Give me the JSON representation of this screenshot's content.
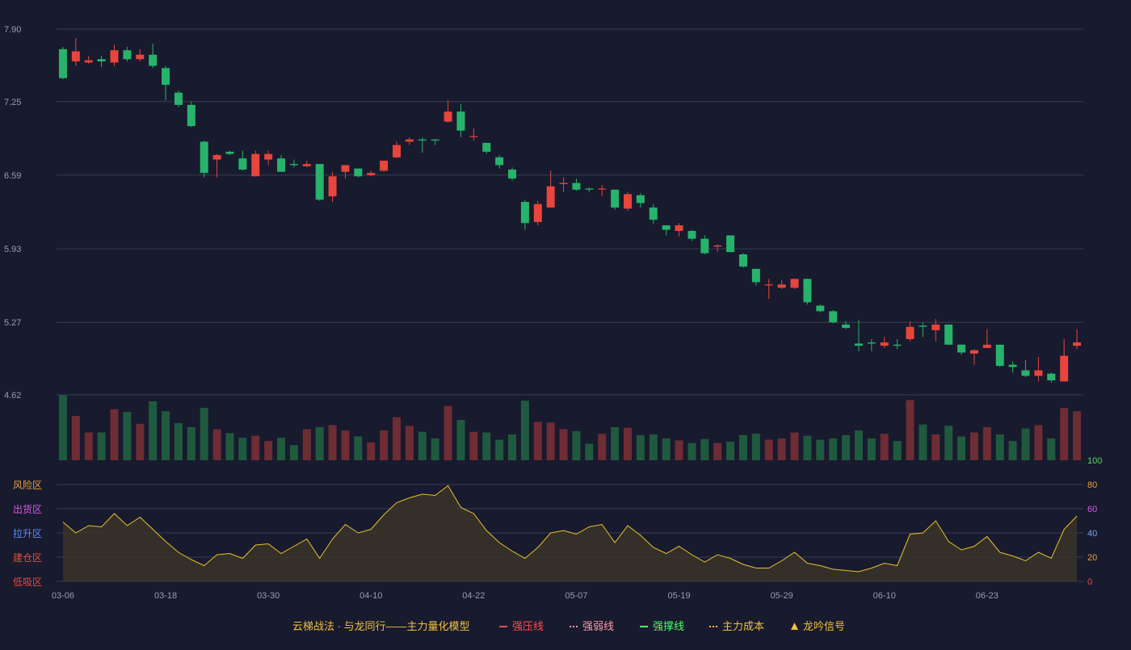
{
  "chart_data": {
    "type": "candlestick",
    "price_ylim": [
      4.62,
      7.9
    ],
    "price_ticks": [
      "7.90",
      "7.25",
      "6.59",
      "5.93",
      "5.27",
      "4.62"
    ],
    "x_ticks": [
      {
        "index": 0,
        "label": "03-06"
      },
      {
        "index": 8,
        "label": "03-18"
      },
      {
        "index": 16,
        "label": "03-30"
      },
      {
        "index": 24,
        "label": "04-10"
      },
      {
        "index": 32,
        "label": "04-22"
      },
      {
        "index": 40,
        "label": "05-07"
      },
      {
        "index": 48,
        "label": "05-19"
      },
      {
        "index": 56,
        "label": "05-29"
      },
      {
        "index": 64,
        "label": "06-10"
      },
      {
        "index": 72,
        "label": "06-23"
      }
    ],
    "candles": [
      [
        7.72,
        7.46,
        7.74,
        7.45
      ],
      [
        7.61,
        7.7,
        7.82,
        7.57
      ],
      [
        7.6,
        7.62,
        7.66,
        7.59
      ],
      [
        7.63,
        7.61,
        7.66,
        7.56
      ],
      [
        7.6,
        7.71,
        7.76,
        7.57
      ],
      [
        7.71,
        7.63,
        7.74,
        7.61
      ],
      [
        7.63,
        7.67,
        7.72,
        7.61
      ],
      [
        7.67,
        7.57,
        7.77,
        7.55
      ],
      [
        7.55,
        7.4,
        7.57,
        7.26
      ],
      [
        7.33,
        7.22,
        7.35,
        7.2
      ],
      [
        7.22,
        7.03,
        7.25,
        7.02
      ],
      [
        6.89,
        6.61,
        6.9,
        6.57
      ],
      [
        6.73,
        6.77,
        6.78,
        6.57
      ],
      [
        6.8,
        6.78,
        6.81,
        6.77
      ],
      [
        6.74,
        6.64,
        6.81,
        6.63
      ],
      [
        6.58,
        6.78,
        6.81,
        6.58
      ],
      [
        6.73,
        6.78,
        6.81,
        6.68
      ],
      [
        6.74,
        6.62,
        6.77,
        6.62
      ],
      [
        6.69,
        6.68,
        6.73,
        6.66
      ],
      [
        6.67,
        6.69,
        6.72,
        6.66
      ],
      [
        6.69,
        6.37,
        6.69,
        6.36
      ],
      [
        6.4,
        6.58,
        6.62,
        6.35
      ],
      [
        6.62,
        6.68,
        6.68,
        6.56
      ],
      [
        6.65,
        6.58,
        6.65,
        6.57
      ],
      [
        6.59,
        6.61,
        6.63,
        6.58
      ],
      [
        6.63,
        6.72,
        6.72,
        6.62
      ],
      [
        6.75,
        6.86,
        6.89,
        6.74
      ],
      [
        6.89,
        6.91,
        6.93,
        6.86
      ],
      [
        6.91,
        6.9,
        6.93,
        6.79
      ],
      [
        6.91,
        6.9,
        6.91,
        6.86
      ],
      [
        7.07,
        7.16,
        7.26,
        7.06
      ],
      [
        7.16,
        6.99,
        7.23,
        6.93
      ],
      [
        6.94,
        6.94,
        7.01,
        6.9
      ],
      [
        6.88,
        6.8,
        6.88,
        6.78
      ],
      [
        6.75,
        6.68,
        6.77,
        6.65
      ],
      [
        6.64,
        6.56,
        6.66,
        6.54
      ],
      [
        6.35,
        6.16,
        6.37,
        6.1
      ],
      [
        6.17,
        6.33,
        6.36,
        6.14
      ],
      [
        6.3,
        6.49,
        6.63,
        6.31
      ],
      [
        6.51,
        6.52,
        6.57,
        6.44
      ],
      [
        6.52,
        6.46,
        6.56,
        6.45
      ],
      [
        6.47,
        6.46,
        6.48,
        6.44
      ],
      [
        6.47,
        6.47,
        6.5,
        6.4
      ],
      [
        6.46,
        6.3,
        6.46,
        6.28
      ],
      [
        6.29,
        6.42,
        6.44,
        6.27
      ],
      [
        6.41,
        6.34,
        6.43,
        6.3
      ],
      [
        6.3,
        6.19,
        6.33,
        6.15
      ],
      [
        6.14,
        6.1,
        6.14,
        6.05
      ],
      [
        6.09,
        6.14,
        6.16,
        6.04
      ],
      [
        6.09,
        6.02,
        6.1,
        6.0
      ],
      [
        6.02,
        5.89,
        6.05,
        5.88
      ],
      [
        5.95,
        5.96,
        5.97,
        5.9
      ],
      [
        6.05,
        5.9,
        6.05,
        5.9
      ],
      [
        5.88,
        5.77,
        5.89,
        5.76
      ],
      [
        5.75,
        5.63,
        5.75,
        5.6
      ],
      [
        5.61,
        5.61,
        5.66,
        5.48
      ],
      [
        5.58,
        5.61,
        5.65,
        5.57
      ],
      [
        5.58,
        5.66,
        5.66,
        5.57
      ],
      [
        5.66,
        5.45,
        5.66,
        5.43
      ],
      [
        5.42,
        5.37,
        5.43,
        5.36
      ],
      [
        5.37,
        5.27,
        5.38,
        5.26
      ],
      [
        5.25,
        5.22,
        5.28,
        5.21
      ],
      [
        5.08,
        5.06,
        5.29,
        5.01
      ],
      [
        5.09,
        5.08,
        5.12,
        5.01
      ],
      [
        5.06,
        5.09,
        5.14,
        5.04
      ],
      [
        5.07,
        5.06,
        5.12,
        5.03
      ],
      [
        5.12,
        5.23,
        5.28,
        5.1
      ],
      [
        5.24,
        5.23,
        5.27,
        5.14
      ],
      [
        5.2,
        5.25,
        5.3,
        5.1
      ],
      [
        5.25,
        5.07,
        5.25,
        5.07
      ],
      [
        5.07,
        5.0,
        5.07,
        4.98
      ],
      [
        4.99,
        5.02,
        5.03,
        4.89
      ],
      [
        5.04,
        5.07,
        5.21,
        5.04
      ],
      [
        5.07,
        4.88,
        5.07,
        4.87
      ],
      [
        4.89,
        4.87,
        4.92,
        4.82
      ],
      [
        4.84,
        4.79,
        4.93,
        4.78
      ],
      [
        4.79,
        4.84,
        4.96,
        4.74
      ],
      [
        4.81,
        4.75,
        4.82,
        4.73
      ],
      [
        4.74,
        4.97,
        5.12,
        4.74
      ],
      [
        5.06,
        5.09,
        5.21,
        5.03
      ]
    ],
    "volume": [
      0.98,
      0.67,
      0.42,
      0.42,
      0.77,
      0.73,
      0.55,
      0.89,
      0.74,
      0.56,
      0.5,
      0.79,
      0.47,
      0.41,
      0.34,
      0.37,
      0.29,
      0.34,
      0.23,
      0.47,
      0.5,
      0.53,
      0.45,
      0.36,
      0.27,
      0.45,
      0.65,
      0.52,
      0.43,
      0.33,
      0.82,
      0.61,
      0.43,
      0.42,
      0.31,
      0.39,
      0.9,
      0.58,
      0.57,
      0.47,
      0.44,
      0.25,
      0.4,
      0.5,
      0.49,
      0.38,
      0.39,
      0.33,
      0.3,
      0.26,
      0.32,
      0.26,
      0.28,
      0.38,
      0.4,
      0.31,
      0.33,
      0.42,
      0.37,
      0.31,
      0.33,
      0.38,
      0.45,
      0.33,
      0.4,
      0.29,
      0.91,
      0.54,
      0.39,
      0.52,
      0.36,
      0.42,
      0.5,
      0.39,
      0.29,
      0.48,
      0.53,
      0.33,
      0.79,
      0.74
    ],
    "indicator": [
      49,
      40,
      46,
      45,
      56,
      46,
      53,
      43,
      33,
      24,
      18,
      13,
      22,
      23,
      19,
      30,
      31,
      23,
      29,
      35,
      19,
      35,
      47,
      40,
      43,
      55,
      65,
      69,
      72,
      71,
      79,
      61,
      56,
      42,
      32,
      25,
      19,
      28,
      40,
      42,
      39,
      45,
      47,
      32,
      46,
      38,
      28,
      23,
      29,
      22,
      16,
      22,
      19,
      14,
      11,
      11,
      17,
      24,
      15,
      13,
      10,
      9,
      8,
      11,
      15,
      13,
      39,
      40,
      50,
      33,
      26,
      29,
      37,
      24,
      21,
      17,
      24,
      19,
      43,
      54
    ],
    "indicator_ticks": [
      "100",
      "80",
      "60",
      "40",
      "20",
      "0"
    ],
    "indicator_tick_colors": [
      "#4cd964",
      "#e6a23c",
      "#d85ae6",
      "#7aa2f7",
      "#e8a040",
      "#e84a3c"
    ],
    "zones": [
      {
        "label": "风险区",
        "color": "#e6a23c"
      },
      {
        "label": "出货区",
        "color": "#d85ae6"
      },
      {
        "label": "拉升区",
        "color": "#5b8ff9"
      },
      {
        "label": "建仓区",
        "color": "#e84a3c"
      },
      {
        "label": "低吸区",
        "color": "#e84a3c"
      }
    ],
    "legend": [
      {
        "label": "云梯战法 · 与龙同行——主力量化模型",
        "color": "#f0c040",
        "marker": "none"
      },
      {
        "label": "强压线",
        "color": "#ff4d4d",
        "marker": "solid-line"
      },
      {
        "label": "强弱线",
        "color": "#ff9aa8",
        "marker": "dash-line"
      },
      {
        "label": "强撑线",
        "color": "#4cff6a",
        "marker": "solid-line"
      },
      {
        "label": "主力成本",
        "color": "#f0c040",
        "marker": "dash-line"
      },
      {
        "label": "龙吟信号",
        "color": "#f0c040",
        "marker": "triangle"
      }
    ],
    "colors": {
      "up": "#e8453c",
      "down": "#27b36b",
      "up_volume": "#6e2c34",
      "down_volume": "#1f5a3e",
      "indicator_line": "#e6c229",
      "indicator_fill": "#3a3428",
      "grid": "#3a3d52",
      "axis_text": "#9a9cae"
    }
  }
}
